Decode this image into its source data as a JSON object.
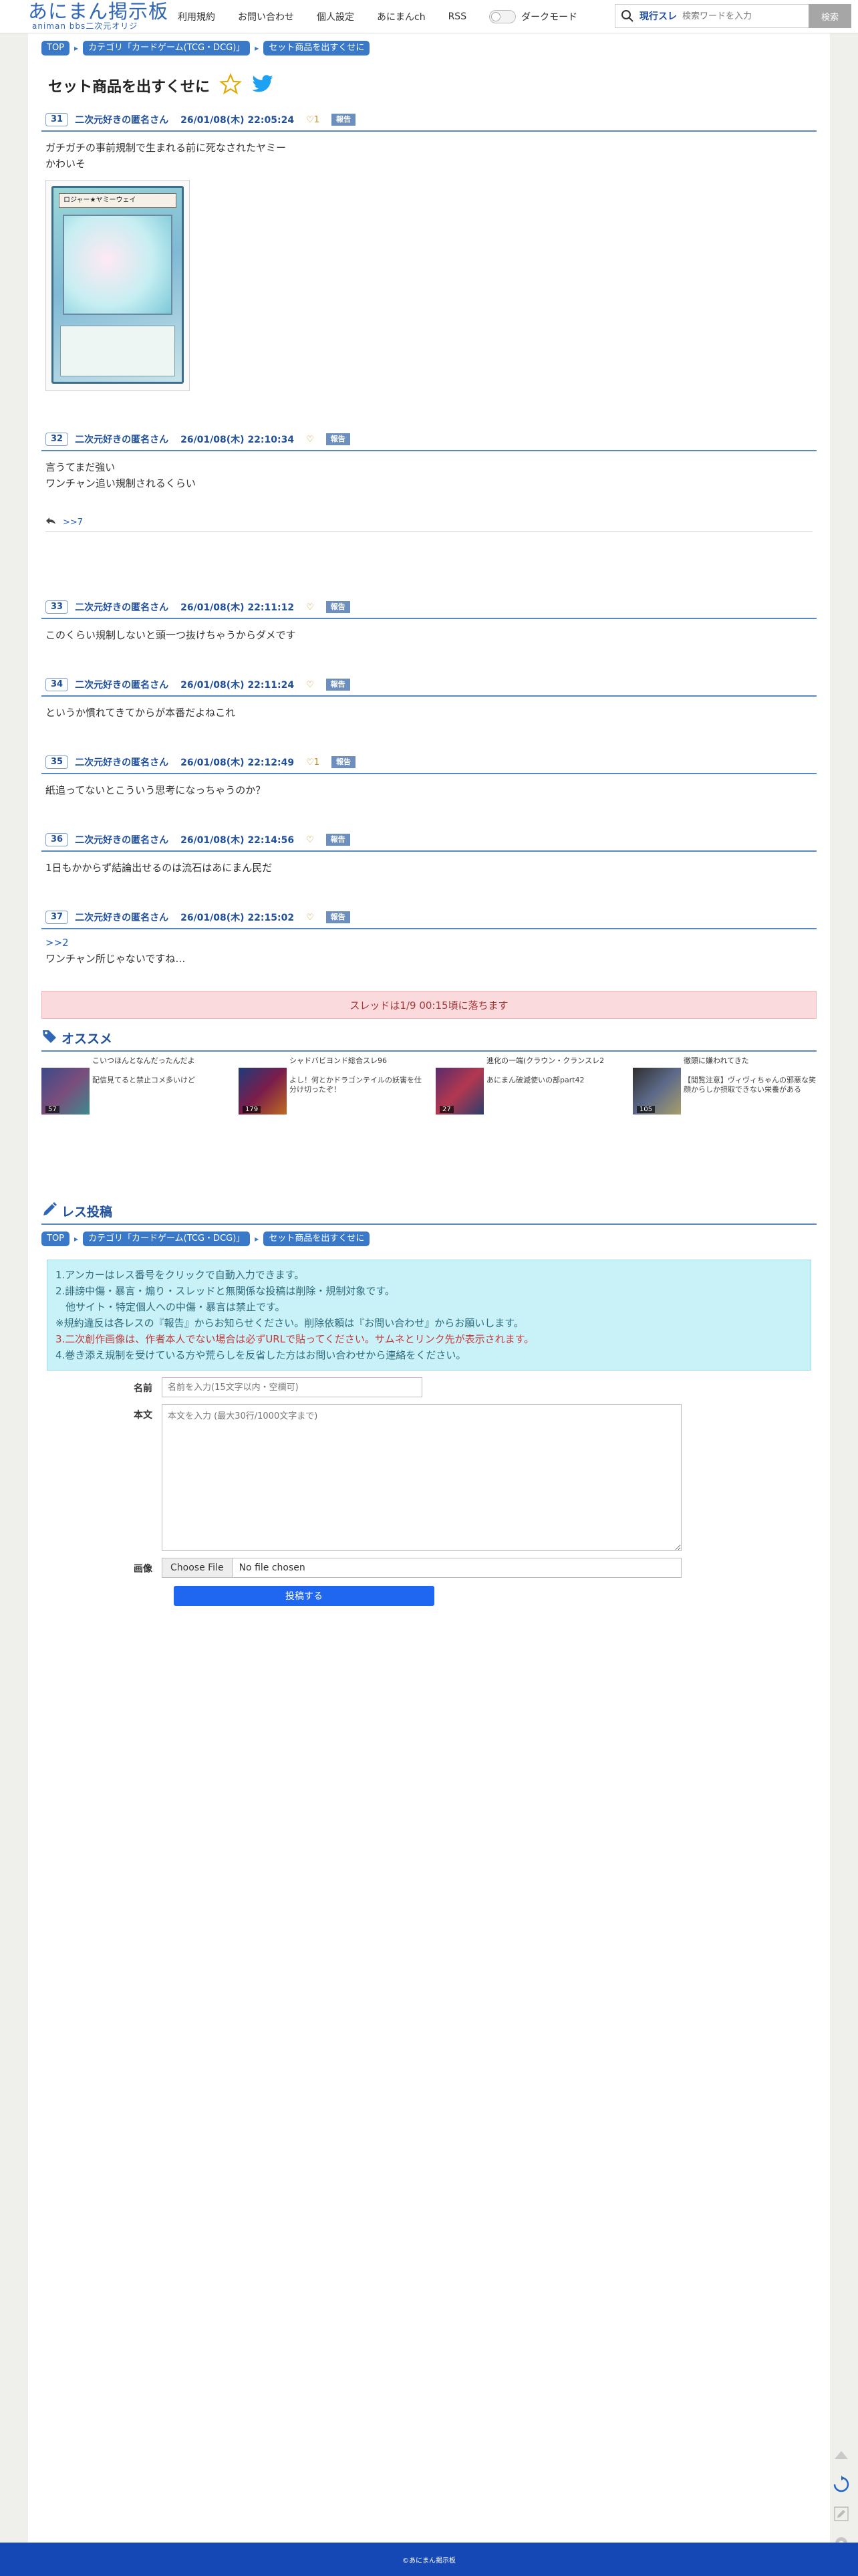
{
  "header": {
    "logo_main": "あにまん掲示板",
    "logo_sub": "animan bbs二次元オリジ",
    "nav": [
      "利用規約",
      "お問い合わせ",
      "個人設定",
      "あにまんch",
      "RSS"
    ],
    "darkmode_label": "ダークモード",
    "search_scope": "現行スレ",
    "search_placeholder": "検索ワードを入力",
    "search_button": "検索"
  },
  "breadcrumb": [
    "TOP",
    "カテゴリ「カードゲーム(TCG・DCG)」",
    "セット商品を出すくせに"
  ],
  "thread_title": "セット商品を出すくせに",
  "posts": [
    {
      "no": "31",
      "name": "二次元好きの匿名さん",
      "date": "26/01/08(木) 22:05:24",
      "likes": "1",
      "report": "報告",
      "lines": [
        "ガチガチの事前規制で生まれる前に死なされたヤミー",
        "かわいそ"
      ],
      "card_name": "ロジャー★ヤミーウェイ"
    },
    {
      "no": "32",
      "name": "二次元好きの匿名さん",
      "date": "26/01/08(木) 22:10:34",
      "likes": "",
      "report": "報告",
      "lines": [
        "言うてまだ強い",
        "ワンチャン追い規制されるくらい"
      ],
      "anchor": ">>7"
    },
    {
      "no": "33",
      "name": "二次元好きの匿名さん",
      "date": "26/01/08(木) 22:11:12",
      "likes": "",
      "report": "報告",
      "lines": [
        "このくらい規制しないと頭一つ抜けちゃうからダメです"
      ]
    },
    {
      "no": "34",
      "name": "二次元好きの匿名さん",
      "date": "26/01/08(木) 22:11:24",
      "likes": "",
      "report": "報告",
      "lines": [
        "というか慣れてきてからが本番だよねこれ"
      ]
    },
    {
      "no": "35",
      "name": "二次元好きの匿名さん",
      "date": "26/01/08(木) 22:12:49",
      "likes": "1",
      "report": "報告",
      "lines": [
        "紙追ってないとこういう思考になっちゃうのか？"
      ]
    },
    {
      "no": "36",
      "name": "二次元好きの匿名さん",
      "date": "26/01/08(木) 22:14:56",
      "likes": "",
      "report": "報告",
      "lines": [
        "1日もかからず結論出せるのは流石はあにまん民だ"
      ]
    },
    {
      "no": "37",
      "name": "二次元好きの匿名さん",
      "date": "26/01/08(木) 22:15:02",
      "likes": "",
      "report": "報告",
      "reply_to": ">>2",
      "lines": [
        "ワンチャン所じゃないですね…"
      ]
    }
  ],
  "fall_notice": "スレッドは1/9 00:15頃に落ちます",
  "recommend": {
    "title": "オススメ",
    "items": [
      {
        "title": "こいつほんとなんだったんだよ",
        "count": "57",
        "desc": "配信見てると禁止コメ多いけど"
      },
      {
        "title": "シャドバビヨンド総合スレ96",
        "count": "179",
        "desc": "よし！何とかドラゴンテイルの妖害を仕分け切ったぞ！"
      },
      {
        "title": "進化の一端(クラウン・クランスレ2",
        "count": "27",
        "desc": "あにまん破滅使いの部part42"
      },
      {
        "title": "徹頭に嫌われてきた",
        "count": "105",
        "desc": "【閲覧注意】ヴィヴィちゃんの邪悪な笑顔からしか摂取できない栄養がある"
      }
    ]
  },
  "reply_form": {
    "title": "レス投稿",
    "rules": [
      "1.アンカーはレス番号をクリックで自動入力できます。",
      "2.誹謗中傷・暴言・煽り・スレッドと無関係な投稿は削除・規制対象です。",
      "　他サイト・特定個人への中傷・暴言は禁止です。",
      "※規約違反は各レスの『報告』からお知らせください。削除依頼は『お問い合わせ』からお願いします。",
      "3.二次創作画像は、作者本人でない場合は必ずURLで貼ってください。サムネとリンク先が表示されます。",
      "4.巻き添え規制を受けている方や荒らしを反省した方はお問い合わせから連絡をください。"
    ],
    "name_label": "名前",
    "name_placeholder": "名前を入力(15文字以内・空欄可)",
    "body_label": "本文",
    "body_placeholder": "本文を入力 (最大30行/1000文字まで)",
    "image_label": "画像",
    "file_button": "Choose File",
    "file_status": "No file chosen",
    "submit": "投稿する"
  },
  "footer": "©あにまん掲示板",
  "colors": {
    "accent": "#3a78c8",
    "footer": "#1547b5",
    "submit": "#1f66f0"
  }
}
